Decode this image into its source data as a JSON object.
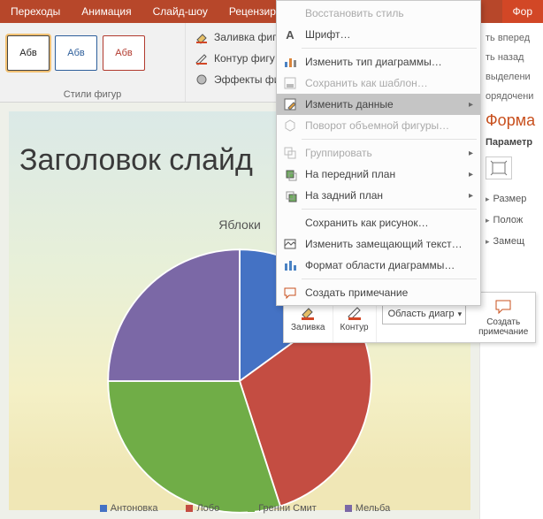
{
  "tabs": {
    "transitions": "Переходы",
    "animation": "Анимация",
    "slideshow": "Слайд-шоу",
    "review": "Рецензиров",
    "format": "Фор"
  },
  "ribbon": {
    "swatch_label": "Абв",
    "shape_styles_label": "Стили фигур",
    "fill": "Заливка фиг",
    "outline": "Контур фигу",
    "effects": "Эффекты фи"
  },
  "sidebar": {
    "bring_forward": "ть вперед",
    "send_backward": "ть назад",
    "selection": "выделени",
    "arrange": "орядочени",
    "pane_title": "Форма",
    "pane_sub": "Параметр",
    "size": "Размер",
    "position": "Полож",
    "alt_text": "Замещ"
  },
  "slide": {
    "title": "Заголовок слайд"
  },
  "chart_data": {
    "type": "pie",
    "title": "Яблоки",
    "categories": [
      "Антоновка",
      "Лобо",
      "Гренни Смит",
      "Мельба"
    ],
    "values": [
      15,
      30,
      30,
      25
    ],
    "colors": [
      "#4472c4",
      "#c44d42",
      "#70ad47",
      "#7b68a6"
    ]
  },
  "mini_toolbar": {
    "fill": "Заливка",
    "outline": "Контур",
    "chart_area": "Область диагр",
    "new_comment_l1": "Создать",
    "new_comment_l2": "примечание"
  },
  "context_menu": {
    "reset_style": "Восстановить стиль",
    "font": "Шрифт…",
    "change_chart_type": "Изменить тип диаграммы…",
    "save_as_template": "Сохранить как шаблон…",
    "edit_data": "Изменить данные",
    "rotate_3d": "Поворот объемной фигуры…",
    "group": "Группировать",
    "bring_to_front": "На передний план",
    "send_to_back": "На задний план",
    "save_as_picture": "Сохранить как рисунок…",
    "edit_alt_text": "Изменить замещающий текст…",
    "format_chart_area": "Формат области диаграммы…",
    "new_comment": "Создать примечание"
  }
}
